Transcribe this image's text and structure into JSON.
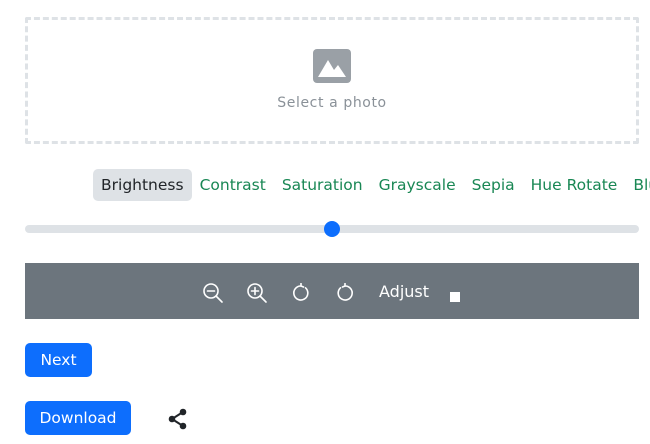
{
  "upload": {
    "icon": "image-icon",
    "label": "Select a photo"
  },
  "filters": {
    "items": [
      "Brightness",
      "Contrast",
      "Saturation",
      "Grayscale",
      "Sepia",
      "Hue Rotate",
      "Blur"
    ],
    "active_index": 0
  },
  "slider": {
    "value_fraction": 0.5
  },
  "toolbar": {
    "zoom_out_icon": "zoom-out-icon",
    "zoom_in_icon": "zoom-in-icon",
    "rotate_right_icon": "rotate-clockwise-icon",
    "rotate_left_icon": "rotate-counterclockwise-icon",
    "adjust_label": "Adjust",
    "adjust_icon": "stop-square-icon"
  },
  "actions": {
    "next_label": "Next",
    "download_label": "Download",
    "share_icon": "share-icon"
  },
  "colors": {
    "primary": "#0d6efd",
    "filter_text": "#198754",
    "active_filter_bg": "#dee2e6",
    "toolbar_bg": "#6c757d",
    "dropzone_border": "#dee2e6"
  }
}
